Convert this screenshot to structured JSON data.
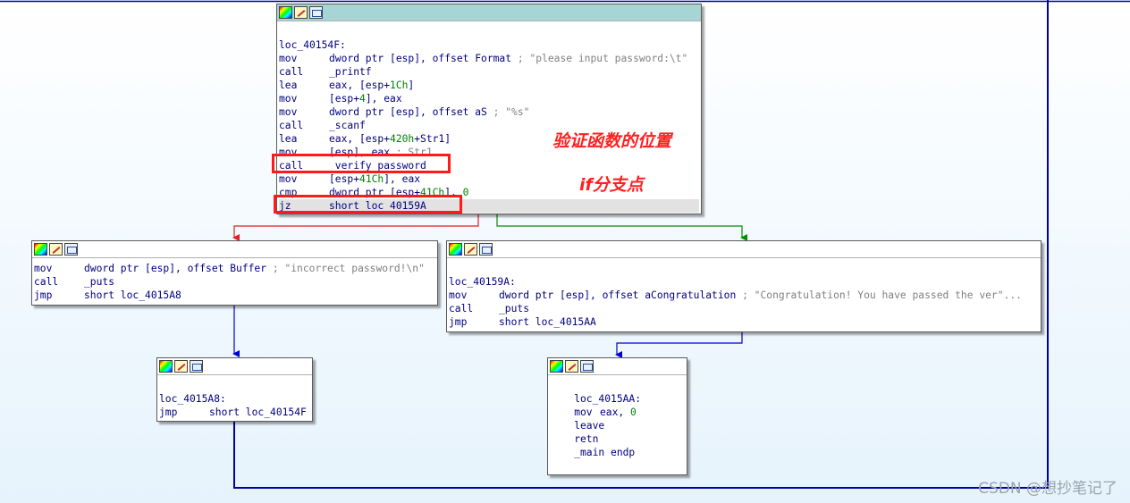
{
  "nodes": {
    "main": {
      "lines": [
        {
          "label": ""
        },
        {
          "label": "loc_40154F:"
        },
        {
          "mnem": "mov",
          "ops": [
            [
              "dword ptr [esp], offset Format",
              ""
            ]
          ],
          "comment": "; \"please input password:\\t\""
        },
        {
          "mnem": "call",
          "ops": [
            [
              "_printf",
              ""
            ]
          ]
        },
        {
          "mnem": "lea",
          "ops": [
            [
              "eax, [esp+",
              ""
            ],
            [
              "1Ch",
              "n"
            ],
            [
              "]",
              ""
            ]
          ]
        },
        {
          "mnem": "mov",
          "ops": [
            [
              "[esp+",
              ""
            ],
            [
              "4",
              "n"
            ],
            [
              "], eax",
              ""
            ]
          ]
        },
        {
          "mnem": "mov",
          "ops": [
            [
              "dword ptr [esp], offset aS",
              ""
            ]
          ],
          "comment": "; \"%s\""
        },
        {
          "mnem": "call",
          "ops": [
            [
              "_scanf",
              ""
            ]
          ]
        },
        {
          "mnem": "lea",
          "ops": [
            [
              "eax, [esp+",
              ""
            ],
            [
              "420h",
              "n"
            ],
            [
              "+Str1]",
              ""
            ]
          ]
        },
        {
          "mnem": "mov",
          "ops": [
            [
              "[esp], eax",
              ""
            ]
          ],
          "comment": "; Str1"
        },
        {
          "mnem": "call",
          "ops": [
            [
              "_verify_password",
              ""
            ]
          ]
        },
        {
          "mnem": "mov",
          "ops": [
            [
              "[esp+",
              ""
            ],
            [
              "41Ch",
              "n"
            ],
            [
              "], eax",
              ""
            ]
          ]
        },
        {
          "mnem": "cmp",
          "ops": [
            [
              "dword ptr [esp+",
              ""
            ],
            [
              "41Ch",
              "n"
            ],
            [
              "], ",
              ""
            ],
            [
              "0",
              "n"
            ]
          ]
        },
        {
          "mnem": "jz",
          "ops": [
            [
              "short loc_40159A",
              ""
            ]
          ],
          "hl": true
        }
      ]
    },
    "incorrect": {
      "lines": [
        {
          "mnem": "mov",
          "ops": [
            [
              "dword ptr [esp], offset Buffer",
              ""
            ]
          ],
          "comment": "; \"incorrect password!\\n\""
        },
        {
          "mnem": "call",
          "ops": [
            [
              "_puts",
              ""
            ]
          ]
        },
        {
          "mnem": "jmp",
          "ops": [
            [
              "short loc_4015A8",
              ""
            ]
          ]
        }
      ]
    },
    "congrat": {
      "lines": [
        {
          "label": ""
        },
        {
          "label": "loc_40159A:"
        },
        {
          "mnem": "mov",
          "ops": [
            [
              "dword ptr [esp], offset aCongratulation",
              ""
            ]
          ],
          "comment": "; \"Congratulation! You have passed the ver\"..."
        },
        {
          "mnem": "call",
          "ops": [
            [
              "_puts",
              ""
            ]
          ]
        },
        {
          "mnem": "jmp",
          "ops": [
            [
              "short loc_4015AA",
              ""
            ]
          ]
        }
      ]
    },
    "loop": {
      "lines": [
        {
          "label": ""
        },
        {
          "label": "loc_4015A8:"
        },
        {
          "mnem": "jmp",
          "ops": [
            [
              "short loc_40154F",
              ""
            ]
          ]
        }
      ]
    },
    "exit": {
      "lines": [
        {
          "label": ""
        },
        {
          "label": "    loc_4015AA:"
        },
        {
          "mnem": "    mov",
          "ops": [
            [
              "eax, ",
              ""
            ],
            [
              "0",
              "n"
            ]
          ]
        },
        {
          "mnem": "    leave",
          "ops": []
        },
        {
          "mnem": "    retn",
          "ops": []
        },
        {
          "mnem": "    _main endp",
          "ops": []
        }
      ]
    }
  },
  "annotations": {
    "verify_label": "验证函数的位置",
    "branch_label": "if分支点"
  },
  "watermark": "CSDN @想抄笔记了",
  "colors": {
    "true_edge": "#009000",
    "false_edge": "#e02020",
    "flow_edge": "#0000d0",
    "back_edge": "#0000a0",
    "highlight": "#ff1a1a"
  }
}
